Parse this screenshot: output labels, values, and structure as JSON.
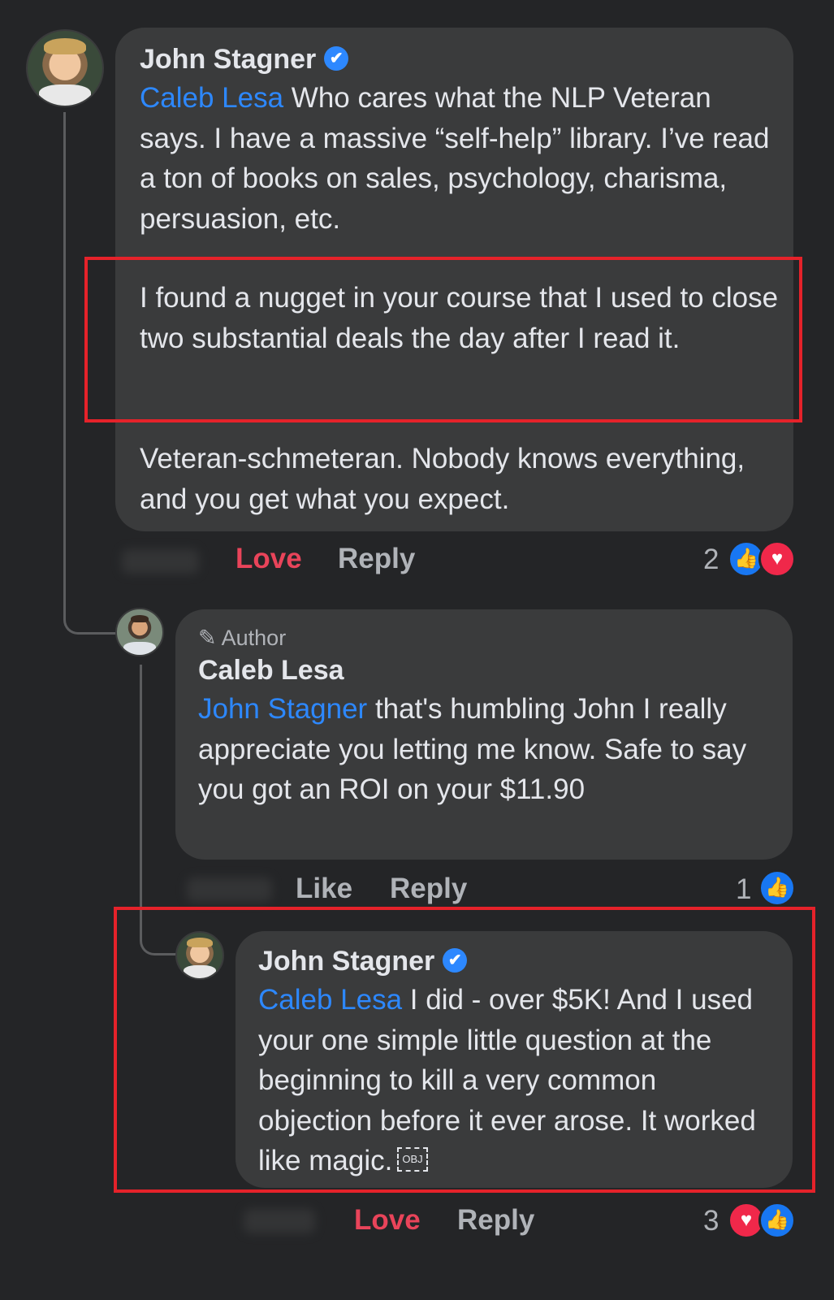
{
  "comments": [
    {
      "author": "John Stagner",
      "mention": "Caleb Lesa",
      "para1_rest": " Who cares what the NLP Veteran says. I have a massive “self-help” library. I’ve read a ton of books on sales, psychology, charisma, persuasion, etc.",
      "para2": "I found a nugget in your course that I used to close two substantial deals the day after I read it.",
      "para3": "Veteran-schmeteran. Nobody knows everything, and you get what you expect.",
      "actions": {
        "primary": "Love",
        "reply": "Reply"
      },
      "reaction_count": "2",
      "reactions": [
        "like-icon",
        "love-icon"
      ]
    },
    {
      "badge": "Author",
      "author": "Caleb Lesa",
      "mention": "John Stagner",
      "text_rest": " that's humbling John I really appreciate you letting me know. Safe to say you got an ROI on your $11.90",
      "actions": {
        "primary": "Like",
        "reply": "Reply"
      },
      "reaction_count": "1",
      "reactions": [
        "like-icon"
      ]
    },
    {
      "author": "John Stagner",
      "mention": "Caleb Lesa",
      "text_rest": " I did - over $5K! And I used your one simple little question at the beginning to kill a very common objection before it ever arose. It worked like magic.",
      "obj_glyph": "OBJ",
      "actions": {
        "primary": "Love",
        "reply": "Reply"
      },
      "reaction_count": "3",
      "reactions": [
        "love-icon",
        "like-icon"
      ]
    }
  ],
  "colors": {
    "background": "#242527",
    "bubble": "#3a3b3c",
    "mention": "#2d88ff",
    "love": "#e9445a",
    "highlight": "#e5222a"
  }
}
